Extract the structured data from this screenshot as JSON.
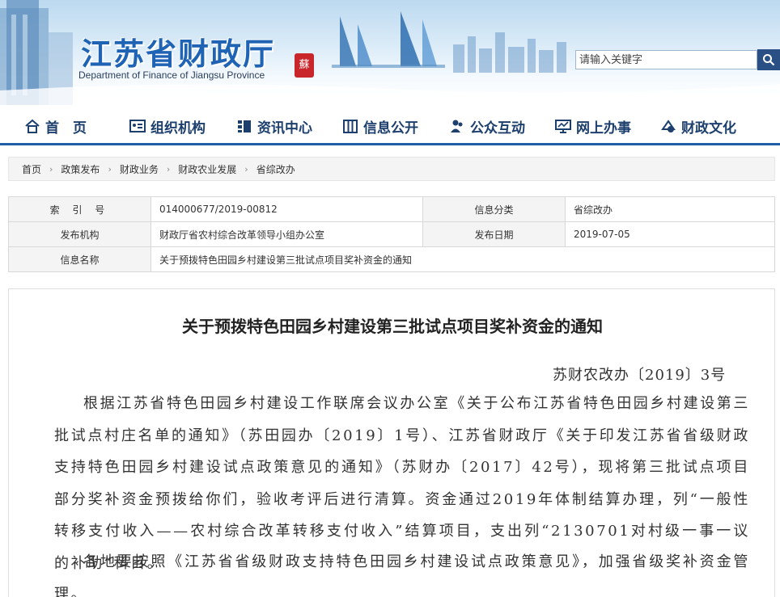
{
  "header": {
    "title": "江苏省财政厅",
    "subtitle": "Department of Finance of Jiangsu Province",
    "seal_char": "蘇",
    "search": {
      "placeholder": "请输入关键字"
    }
  },
  "nav": [
    {
      "label": "首　页",
      "icon": "home-icon"
    },
    {
      "label": "组织机构",
      "icon": "org-card-icon"
    },
    {
      "label": "资讯中心",
      "icon": "news-list-icon"
    },
    {
      "label": "信息公开",
      "icon": "columns-icon"
    },
    {
      "label": "公众互动",
      "icon": "people-icon"
    },
    {
      "label": "网上办事",
      "icon": "monitor-icon"
    },
    {
      "label": "财政文化",
      "icon": "culture-icon"
    }
  ],
  "breadcrumb": [
    "首页",
    "政策发布",
    "财政业务",
    "财政农业发展",
    "省综改办"
  ],
  "info": {
    "index_label": "索 引 号",
    "index_value": "014000677/2019-00812",
    "category_label": "信息分类",
    "category_value": "省综改办",
    "publisher_label": "发布机构",
    "publisher_value": "财政厅省农村综合改革领导小组办公室",
    "date_label": "发布日期",
    "date_value": "2019-07-05",
    "name_label": "信息名称",
    "name_value": "关于预拨特色田园乡村建设第三批试点项目奖补资金的通知"
  },
  "article": {
    "title": "关于预拨特色田园乡村建设第三批试点项目奖补资金的通知",
    "doc_number": "苏财农改办〔2019〕3号",
    "paragraphs": [
      "根据江苏省特色田园乡村建设工作联席会议办公室《关于公布江苏省特色田园乡村建设第三批试点村庄名单的通知》（苏田园办〔2019〕1号）、江苏省财政厅《关于印发江苏省省级财政支持特色田园乡村建设试点政策意见的通知》（苏财办〔2017〕42号），现将第三批试点项目部分奖补资金预拨给你们，验收考评后进行清算。资金通过2019年体制结算办理，列“一般性转移支付收入——农村综合改革转移支付收入”结算项目，支出列“2130701对村级一事一议的补助”科目。",
      "各地要按照《江苏省省级财政支持特色田园乡村建设试点政策意见》，加强省级奖补资金管理。"
    ]
  },
  "colors": {
    "brand_blue": "#1f63b5",
    "nav_text": "#1d3f6e",
    "nav_border": "#1e5fa5",
    "seal_red": "#c8262b"
  }
}
